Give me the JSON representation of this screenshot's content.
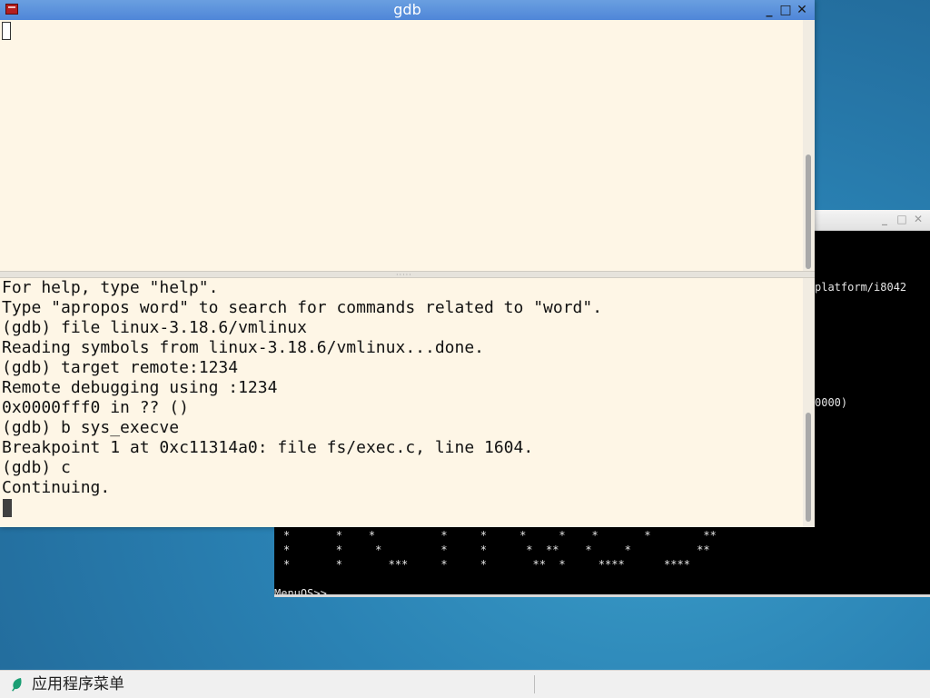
{
  "qemu_window": {
    "minimize_label": "_",
    "maximize_label": "□",
    "close_label": "✕",
    "line_right_1": "platform/i8042",
    "line_right_2": "0000)",
    "art_row_1": "*       *    *          *     *     *     *    *       *        **",
    "art_row_2": "*       *     *         *     *      *  **    *     *          **",
    "art_row_3": "*       *       ***     *     *       **  *     ****      ****",
    "prompt": "MenuOS>>_"
  },
  "gdb_window": {
    "title": "gdb",
    "minimize_label": "_",
    "maximize_label": "□",
    "close_label": "✕",
    "splitter_grip": "·····",
    "console_lines": [
      "For help, type \"help\".",
      "Type \"apropos word\" to search for commands related to \"word\".",
      "(gdb) file linux-3.18.6/vmlinux",
      "Reading symbols from linux-3.18.6/vmlinux...done.",
      "(gdb) target remote:1234",
      "Remote debugging using :1234",
      "0x0000fff0 in ?? ()",
      "(gdb) b sys_execve",
      "Breakpoint 1 at 0xc11314a0: file fs/exec.c, line 1604.",
      "(gdb) c",
      "Continuing."
    ]
  },
  "taskbar": {
    "menu_label": "应用程序菜单",
    "menu_icon": "leaf-icon",
    "accent": "#1a9e73"
  }
}
